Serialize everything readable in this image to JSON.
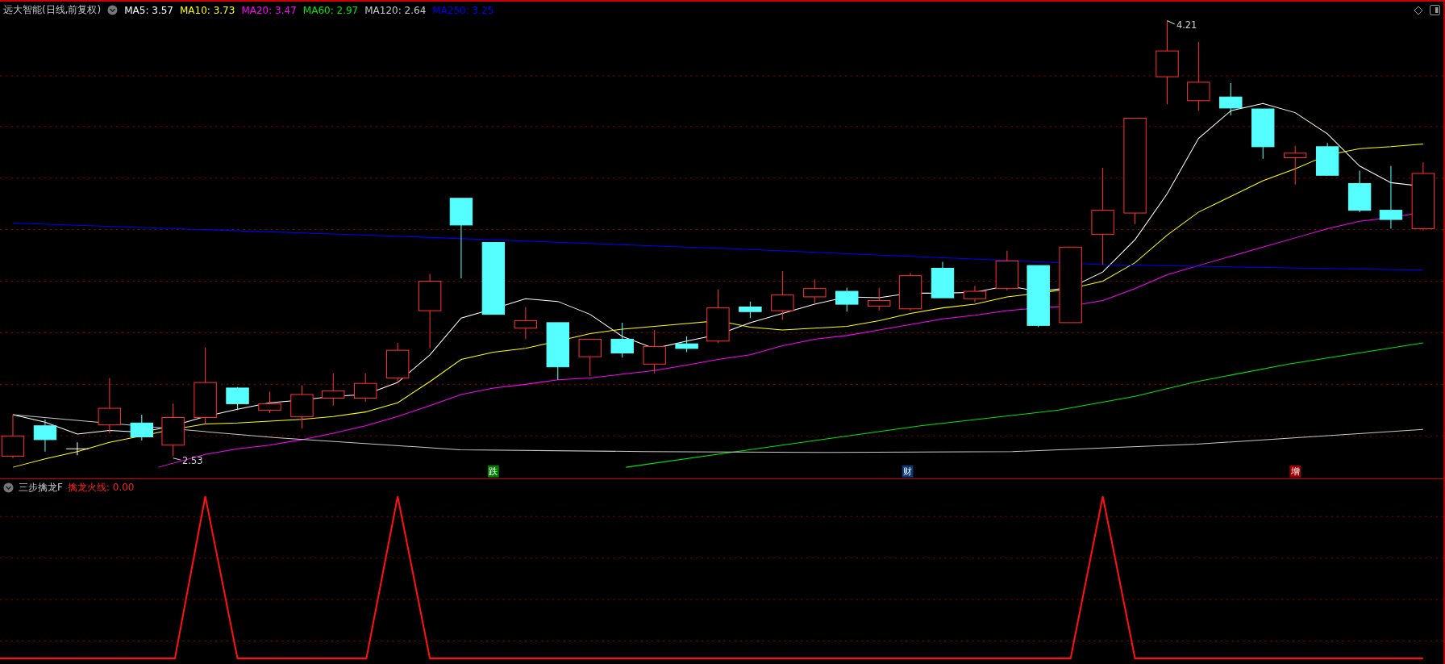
{
  "main_panel": {
    "title": "远大智能(日线,前复权)",
    "moving_averages": [
      {
        "label": "MA5: 3.57",
        "color": "#ffffff"
      },
      {
        "label": "MA10: 3.73",
        "color": "#ffff00"
      },
      {
        "label": "MA20: 3.47",
        "color": "#ff00ff"
      },
      {
        "label": "MA60: 2.97",
        "color": "#00e600"
      },
      {
        "label": "MA120: 2.64",
        "color": "#c8c8c8"
      },
      {
        "label": "MA250: 3.25",
        "color": "#0000ff"
      }
    ],
    "price_labels": [
      "4.21",
      "2.53"
    ],
    "signal_tags": [
      {
        "text": "跌",
        "color": "#008000"
      },
      {
        "text": "财",
        "color": "#0a3a78"
      },
      {
        "text": "增",
        "color": "#a00000"
      }
    ]
  },
  "indicator_panel": {
    "title": "三步擒龙F",
    "value_label": "擒龙火线: 0.00"
  }
}
